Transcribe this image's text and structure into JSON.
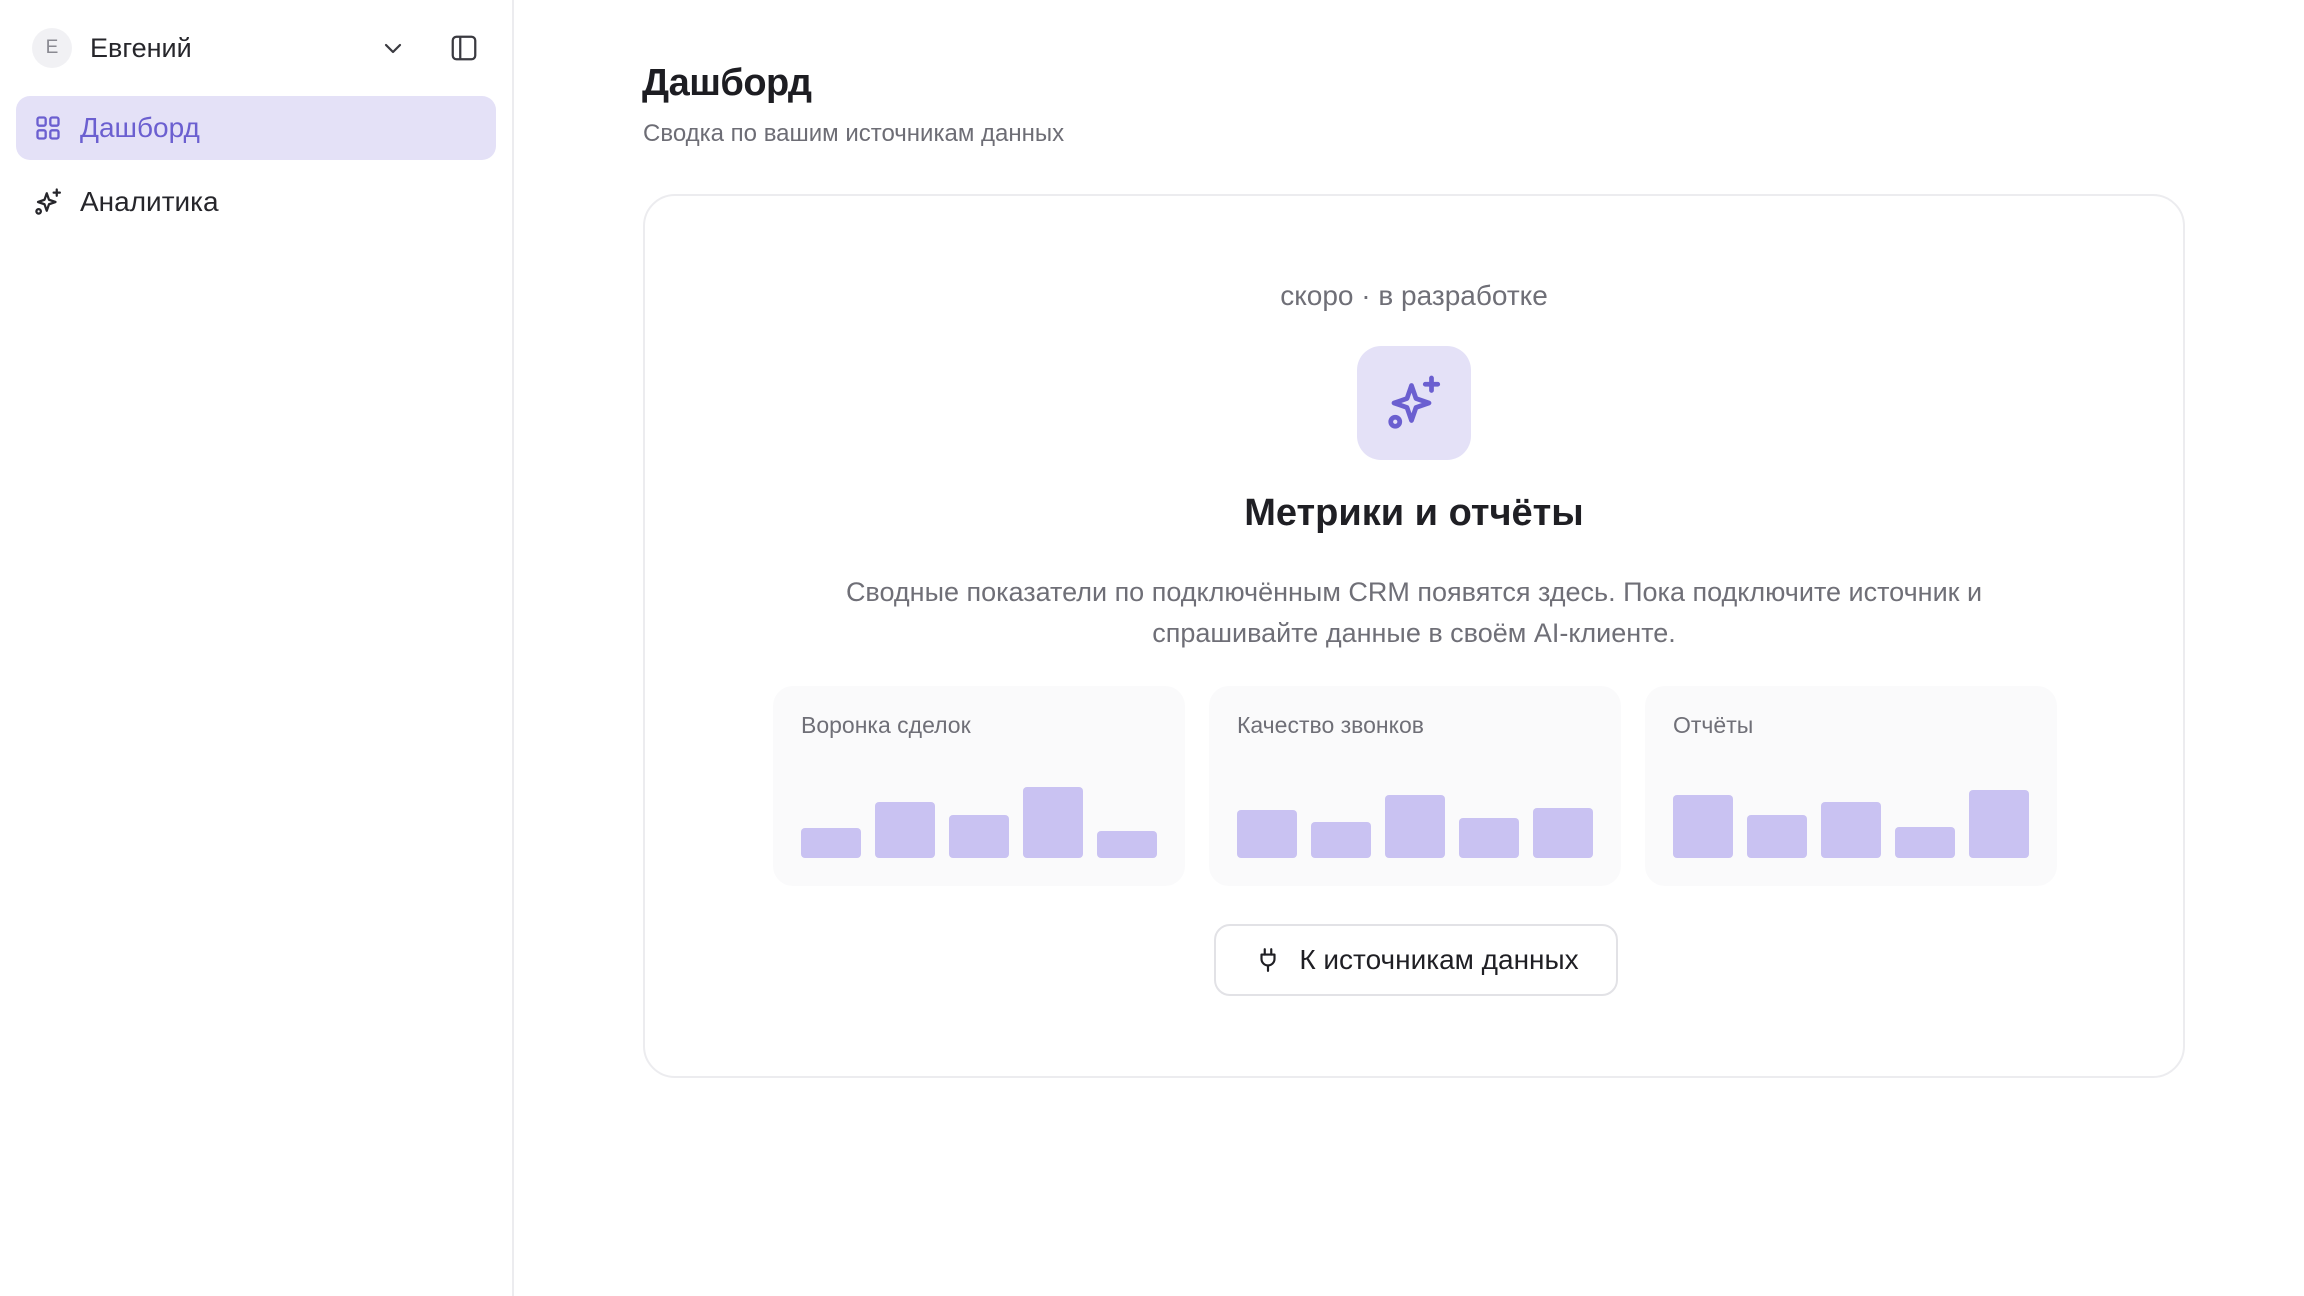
{
  "sidebar": {
    "user": {
      "avatar_letter": "E",
      "name": "Евгений"
    },
    "icons": {
      "chevron": "chevron-down-icon",
      "toggle": "panel-toggle-icon"
    },
    "items": [
      {
        "label": "Дашборд",
        "icon": "grid-icon",
        "active": true
      },
      {
        "label": "Аналитика",
        "icon": "sparkles-icon",
        "active": false
      }
    ]
  },
  "header": {
    "title": "Дашборд",
    "subtitle": "Сводка по вашим источникам данных"
  },
  "card": {
    "badge": "скоро · в разработке",
    "icon": "sparkles-icon",
    "title": "Метрики и отчёты",
    "description": "Сводные показатели по подключённым CRM появятся здесь. Пока подключите источник и спрашивайте данные в своём AI-клиенте.",
    "previews": [
      {
        "title": "Воронка сделок",
        "bars": [
          0.33,
          0.62,
          0.48,
          0.79,
          0.3
        ]
      },
      {
        "title": "Качество звонков",
        "bars": [
          0.53,
          0.4,
          0.7,
          0.45,
          0.56
        ]
      },
      {
        "title": "Отчёты",
        "bars": [
          0.7,
          0.48,
          0.62,
          0.35,
          0.76
        ]
      }
    ],
    "button": {
      "label": "К источникам данных",
      "icon": "plug-icon"
    }
  },
  "colors": {
    "accent": "#6b5fd0",
    "accent_bg": "#e4e1f7",
    "bar": "#c9c2f2"
  }
}
